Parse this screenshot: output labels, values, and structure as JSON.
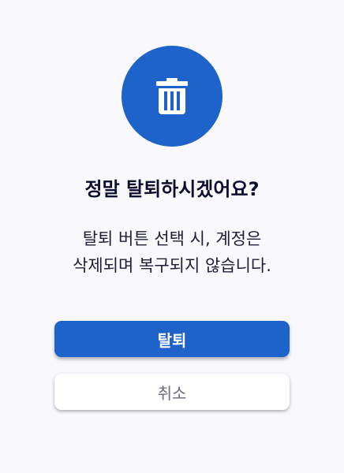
{
  "dialog": {
    "icon": "trash-icon",
    "title": "정말 탈퇴하시겠어요?",
    "message_lines": [
      "탈퇴 버튼 선택 시, 계정은",
      "삭제되며 복구되지 않습니다."
    ],
    "confirm_label": "탈퇴",
    "cancel_label": "취소"
  },
  "colors": {
    "accent": "#1e63c9",
    "background": "#f8f8fd",
    "title_text": "#0d0f2e",
    "cancel_text": "#6a6a78"
  }
}
